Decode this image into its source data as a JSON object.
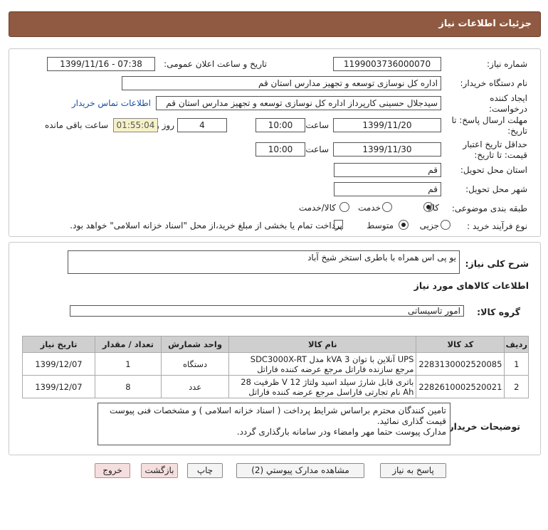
{
  "page": {
    "title": "جزئیات اطلاعات نیاز"
  },
  "info": {
    "need_number_label": "شماره نیاز:",
    "need_number": "1199003736000070",
    "announce_label": "تاریخ و ساعت اعلان عمومی:",
    "announce_value": "1399/11/16 - 07:38",
    "buyer_org_label": "نام دستگاه خریدار:",
    "buyer_org": "اداره کل نوسازی توسعه و تجهیز مدارس استان قم",
    "creator_label": "ایجاد کننده درخواست:",
    "creator": "سیدجلال حسینی کارپرداز اداره کل نوسازی توسعه و تجهیز مدارس استان قم",
    "contact_link": "اطلاعات تماس خریدار",
    "deadline_label": "مهلت ارسال پاسخ: تا تاریخ:",
    "deadline_date": "1399/11/20",
    "time_label": "ساعت",
    "deadline_time": "10:00",
    "days": "4",
    "days_label": "روز و",
    "remaining": "01:55:04",
    "remaining_label": "ساعت باقی مانده",
    "validity_label": "حداقل تاریخ اعتبار قیمت: تا تاریخ:",
    "validity_date": "1399/11/30",
    "validity_time": "10:00",
    "province_label": "استان محل تحویل:",
    "province": "قم",
    "city_label": "شهر محل تحویل:",
    "city": "قم",
    "category_label": "طبقه بندی موضوعی:",
    "category_options": [
      "کالا",
      "خدمت",
      "کالا/خدمت"
    ],
    "process_label": "نوع فرآیند خرید :",
    "process_options": [
      "جزیی",
      "متوسط"
    ],
    "payment_note": "پرداخت تمام یا بخشی از مبلغ خرید،از محل \"اسناد خزانه اسلامی\" خواهد بود."
  },
  "details": {
    "general_desc_label": "شرح کلی نیاز:",
    "general_desc": "یو پی اس همراه با باطری استخر شیخ آباد",
    "goods_info_title": "اطلاعات کالاهای مورد نیاز",
    "goods_group_label": "گروه کالا:",
    "goods_group": "امور تاسیساتی",
    "columns": [
      "ردیف",
      "کد کالا",
      "نام کالا",
      "واحد شمارش",
      "تعداد / مقدار",
      "تاریخ نیاز"
    ],
    "rows": [
      {
        "idx": "1",
        "code": "2283130002520085",
        "name": "UPS آنلاین با توان 3 kVA مدل SDC3000X-RT مرجع سازنده فاراتل مرجع عرضه کننده فاراتل",
        "unit": "دستگاه",
        "qty": "1",
        "date": "1399/12/07"
      },
      {
        "idx": "2",
        "code": "2282610002520021",
        "name": "باتری قابل شارژ سیلد اسید ولتاژ 12 V ظرفیت 28 Ah نام تجارتی فاراسل مرجع عرضه کننده فاراتل",
        "unit": "عدد",
        "qty": "8",
        "date": "1399/12/07"
      }
    ],
    "buyer_notes_label": "توضیحات خریدار:",
    "buyer_notes": "تامین کنندگان محترم براساس شرایط پرداخت ( اسناد خزانه اسلامی ) و مشخصات فنی پیوست قیمت گذاری نمائید.\nمدارک پیوست حتما مهر وامضاء ودر سامانه بارگذاری گردد."
  },
  "buttons": {
    "reply": "پاسخ به نیاز",
    "view_docs": "مشاهده مدارک پیوستي (2)",
    "print": "چاپ",
    "back": "بازگشت",
    "exit": "خروج"
  }
}
